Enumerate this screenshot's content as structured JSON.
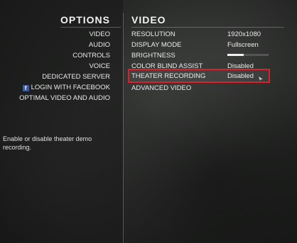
{
  "left_menu": {
    "title": "OPTIONS",
    "items": [
      {
        "label": "VIDEO"
      },
      {
        "label": "AUDIO"
      },
      {
        "label": "CONTROLS"
      },
      {
        "label": "VOICE"
      },
      {
        "label": "DEDICATED SERVER"
      },
      {
        "label": "LOGIN WITH FACEBOOK",
        "icon": "facebook-icon"
      },
      {
        "label": "OPTIMAL VIDEO AND AUDIO"
      }
    ],
    "description": "Enable or disable theater demo recording."
  },
  "video_panel": {
    "title": "VIDEO",
    "settings": [
      {
        "label": "RESOLUTION",
        "value": "1920x1080"
      },
      {
        "label": "DISPLAY MODE",
        "value": "Fullscreen"
      },
      {
        "label": "BRIGHTNESS",
        "value_fraction": 0.4
      },
      {
        "label": "COLOR BLIND ASSIST",
        "value": "Disabled"
      },
      {
        "label": "THEATER RECORDING",
        "value": "Disabled"
      },
      {
        "label": "ADVANCED VIDEO"
      }
    ]
  },
  "colors": {
    "highlight_border": "#d8212a",
    "facebook_blue": "#3b5998"
  }
}
